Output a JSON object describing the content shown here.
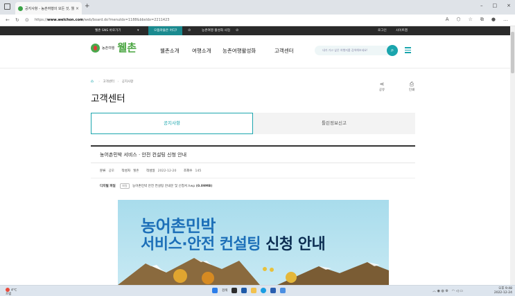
{
  "browser": {
    "tab_title": "공지사항 - 농촌여행의 모든 것, 웰촌",
    "tab_close": "×",
    "new_tab": "+",
    "url_prefix": "https://",
    "url_host": "www.welchon.com",
    "url_path": "/web/board.do?menuIdx=1188&bbsIdx=2211423",
    "window_controls": [
      "–",
      "□",
      "×"
    ]
  },
  "topbar": {
    "sns": "웰촌 SNS 바로가기",
    "where": "으뜸마을은 어디?",
    "project": "농촌여행 활성화 사업",
    "login": "로그인",
    "sitemap": "사이트맵"
  },
  "header": {
    "logo_small": "농촌여행",
    "logo_big": "웰촌",
    "nav": [
      "웰촌소개",
      "여행소개",
      "농촌여행활성화",
      "고객센터"
    ],
    "search_placeholder": "내가 가고 싶은 여행지를 검색해보세요!"
  },
  "breadcrumb": [
    "고객센터",
    "공지사항"
  ],
  "page_title": "고객센터",
  "actions": {
    "share": "공유",
    "print": "인쇄"
  },
  "tabs": {
    "notice": "공지사항",
    "faq": "틀린정보신고"
  },
  "post": {
    "title": "농어촌민박 서비스 · 안전 컨설팅 신청 안내",
    "category_key": "분류",
    "category_val": "공모",
    "author_key": "작성자",
    "author_val": "웰촌",
    "date_key": "작성일",
    "date_val": "2022-12-20",
    "views_key": "조회수",
    "views_val": "145",
    "attach_key": "디지털 파일",
    "attach_icon": "파일",
    "attach_name": "농어촌민박 안전 컨설팅 안내문 및 신청서.hwp",
    "attach_size": "(0.09MB)"
  },
  "banner": {
    "line1": "농어촌민박",
    "line2_a": "서비스·안전 컨설팅",
    "line2_b": " 신청 안내"
  },
  "taskbar": {
    "temp": "4°C",
    "weather": "흐림",
    "search": "검색",
    "time": "오후 9:48",
    "date": "2022-12-24"
  },
  "colors": {
    "accent": "#1aa5ad",
    "logo_green": "#48a43f",
    "banner_blue": "#1c6fb8",
    "topbar_bg": "#2a2a2a"
  }
}
